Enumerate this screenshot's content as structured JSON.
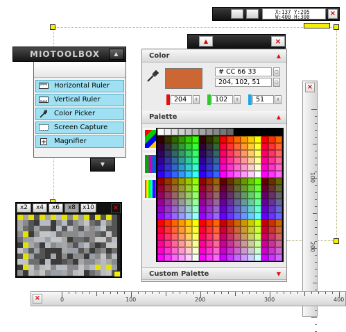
{
  "coords_bar": {
    "line1": "X:137  Y:295",
    "line2": "W:400  H:300",
    "close": "×"
  },
  "toolbox": {
    "title": "MIOTOOLBOX",
    "collapse": "▲",
    "expand": "▼",
    "items": [
      {
        "label": "Horizontal Ruler",
        "icon": "horizontal-ruler-icon"
      },
      {
        "label": "Vertical Ruler",
        "icon": "vertical-ruler-icon"
      },
      {
        "label": "Color Picker",
        "icon": "eyedropper-icon"
      },
      {
        "label": "Screen Capture",
        "icon": "screen-capture-icon"
      },
      {
        "label": "Magnifier",
        "icon": "plus-icon"
      }
    ]
  },
  "color_panel": {
    "close": "×",
    "collapse": "▲",
    "color_section": "Color",
    "hex": "# CC 66 33",
    "rgb": "204, 102, 51",
    "red": "204",
    "green": "102",
    "blue": "51",
    "swatch_color": "#CC6633",
    "palette_section": "Palette",
    "custom_palette_section": "Custom Palette"
  },
  "magnifier": {
    "zooms": [
      "x2",
      "x4",
      "x6",
      "x8",
      "x10"
    ],
    "active_zoom": "x8",
    "close": "×"
  },
  "vertical_ruler": {
    "close": "×",
    "labels": [
      "100",
      "200"
    ]
  },
  "horizontal_ruler": {
    "close": "×",
    "labels": [
      "0",
      "100",
      "200",
      "300",
      "400"
    ]
  },
  "colors": {
    "accent_red": "#dd1111",
    "handle_yellow": "#f4f000",
    "tool_item_bg": "#9fe0f3",
    "panel_dark": "#151515"
  }
}
